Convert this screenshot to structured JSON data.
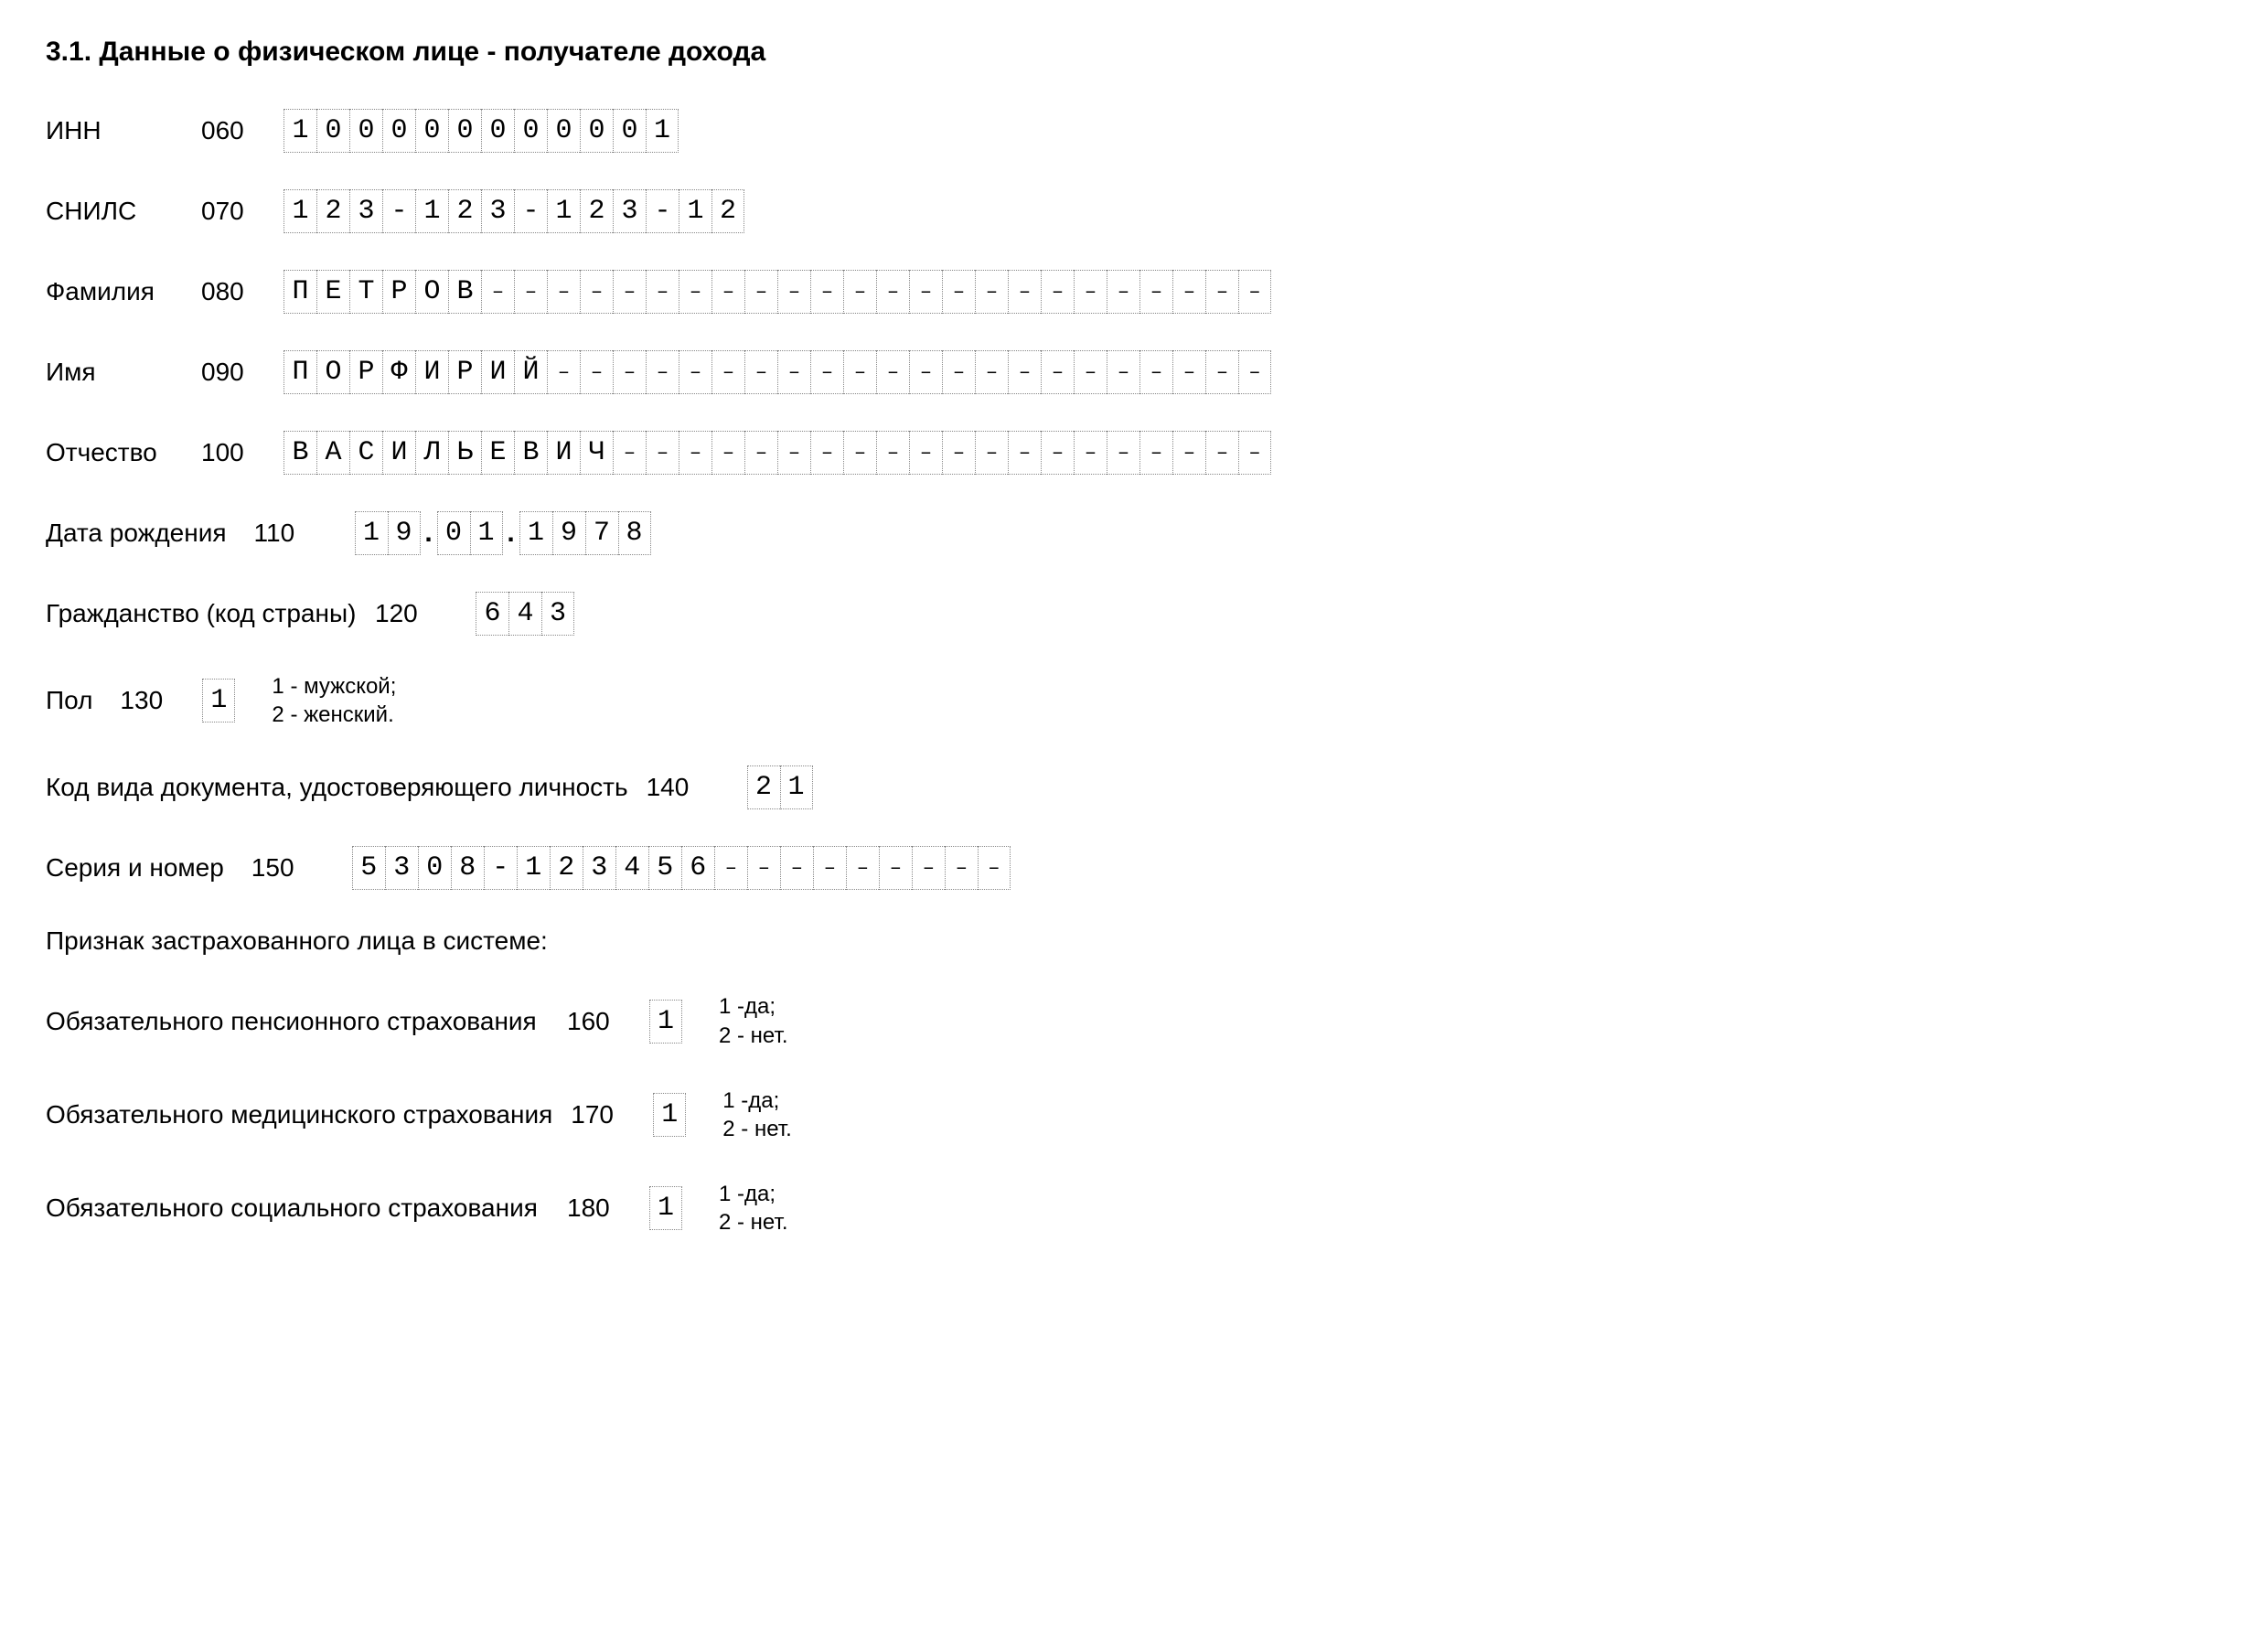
{
  "heading": "3.1. Данные о физическом лице - получателе дохода",
  "fields": {
    "inn": {
      "label": "ИНН",
      "code": "060",
      "value": "100000000001",
      "length": 12
    },
    "snils": {
      "label": "СНИЛС",
      "code": "070",
      "value": "123-123-123-12",
      "length": 14
    },
    "surname": {
      "label": "Фамилия",
      "code": "080",
      "value": "ПЕТРОВ",
      "length": 30
    },
    "firstname": {
      "label": "Имя",
      "code": "090",
      "value": "ПОРФИРИЙ",
      "length": 30
    },
    "patronymic": {
      "label": "Отчество",
      "code": "100",
      "value": "ВАСИЛЬЕВИЧ",
      "length": 30
    },
    "birthdate": {
      "label": "Дата рождения",
      "code": "110",
      "day": "19",
      "month": "01",
      "year": "1978"
    },
    "citizenship": {
      "label": "Гражданство (код страны)",
      "code": "120",
      "value": "643",
      "length": 3
    },
    "gender": {
      "label": "Пол",
      "code": "130",
      "value": "1",
      "length": 1,
      "note1": "1 - мужской;",
      "note2": "2 - женский."
    },
    "doctype": {
      "label": "Код вида документа, удостоверяющего личность",
      "code": "140",
      "value": "21",
      "length": 2
    },
    "docnum": {
      "label": "Серия и номер",
      "code": "150",
      "value": "5308-123456",
      "length": 20
    }
  },
  "insurance": {
    "heading": "Признак застрахованного лица в системе:",
    "note1": "1 -да;",
    "note2": "2 - нет.",
    "pension": {
      "label": "Обязательного пенсионного страхования",
      "code": "160",
      "value": "1"
    },
    "medical": {
      "label": "Обязательного медицинского страхования",
      "code": "170",
      "value": "1"
    },
    "social": {
      "label": "Обязательного социального страхования",
      "code": "180",
      "value": "1"
    }
  }
}
